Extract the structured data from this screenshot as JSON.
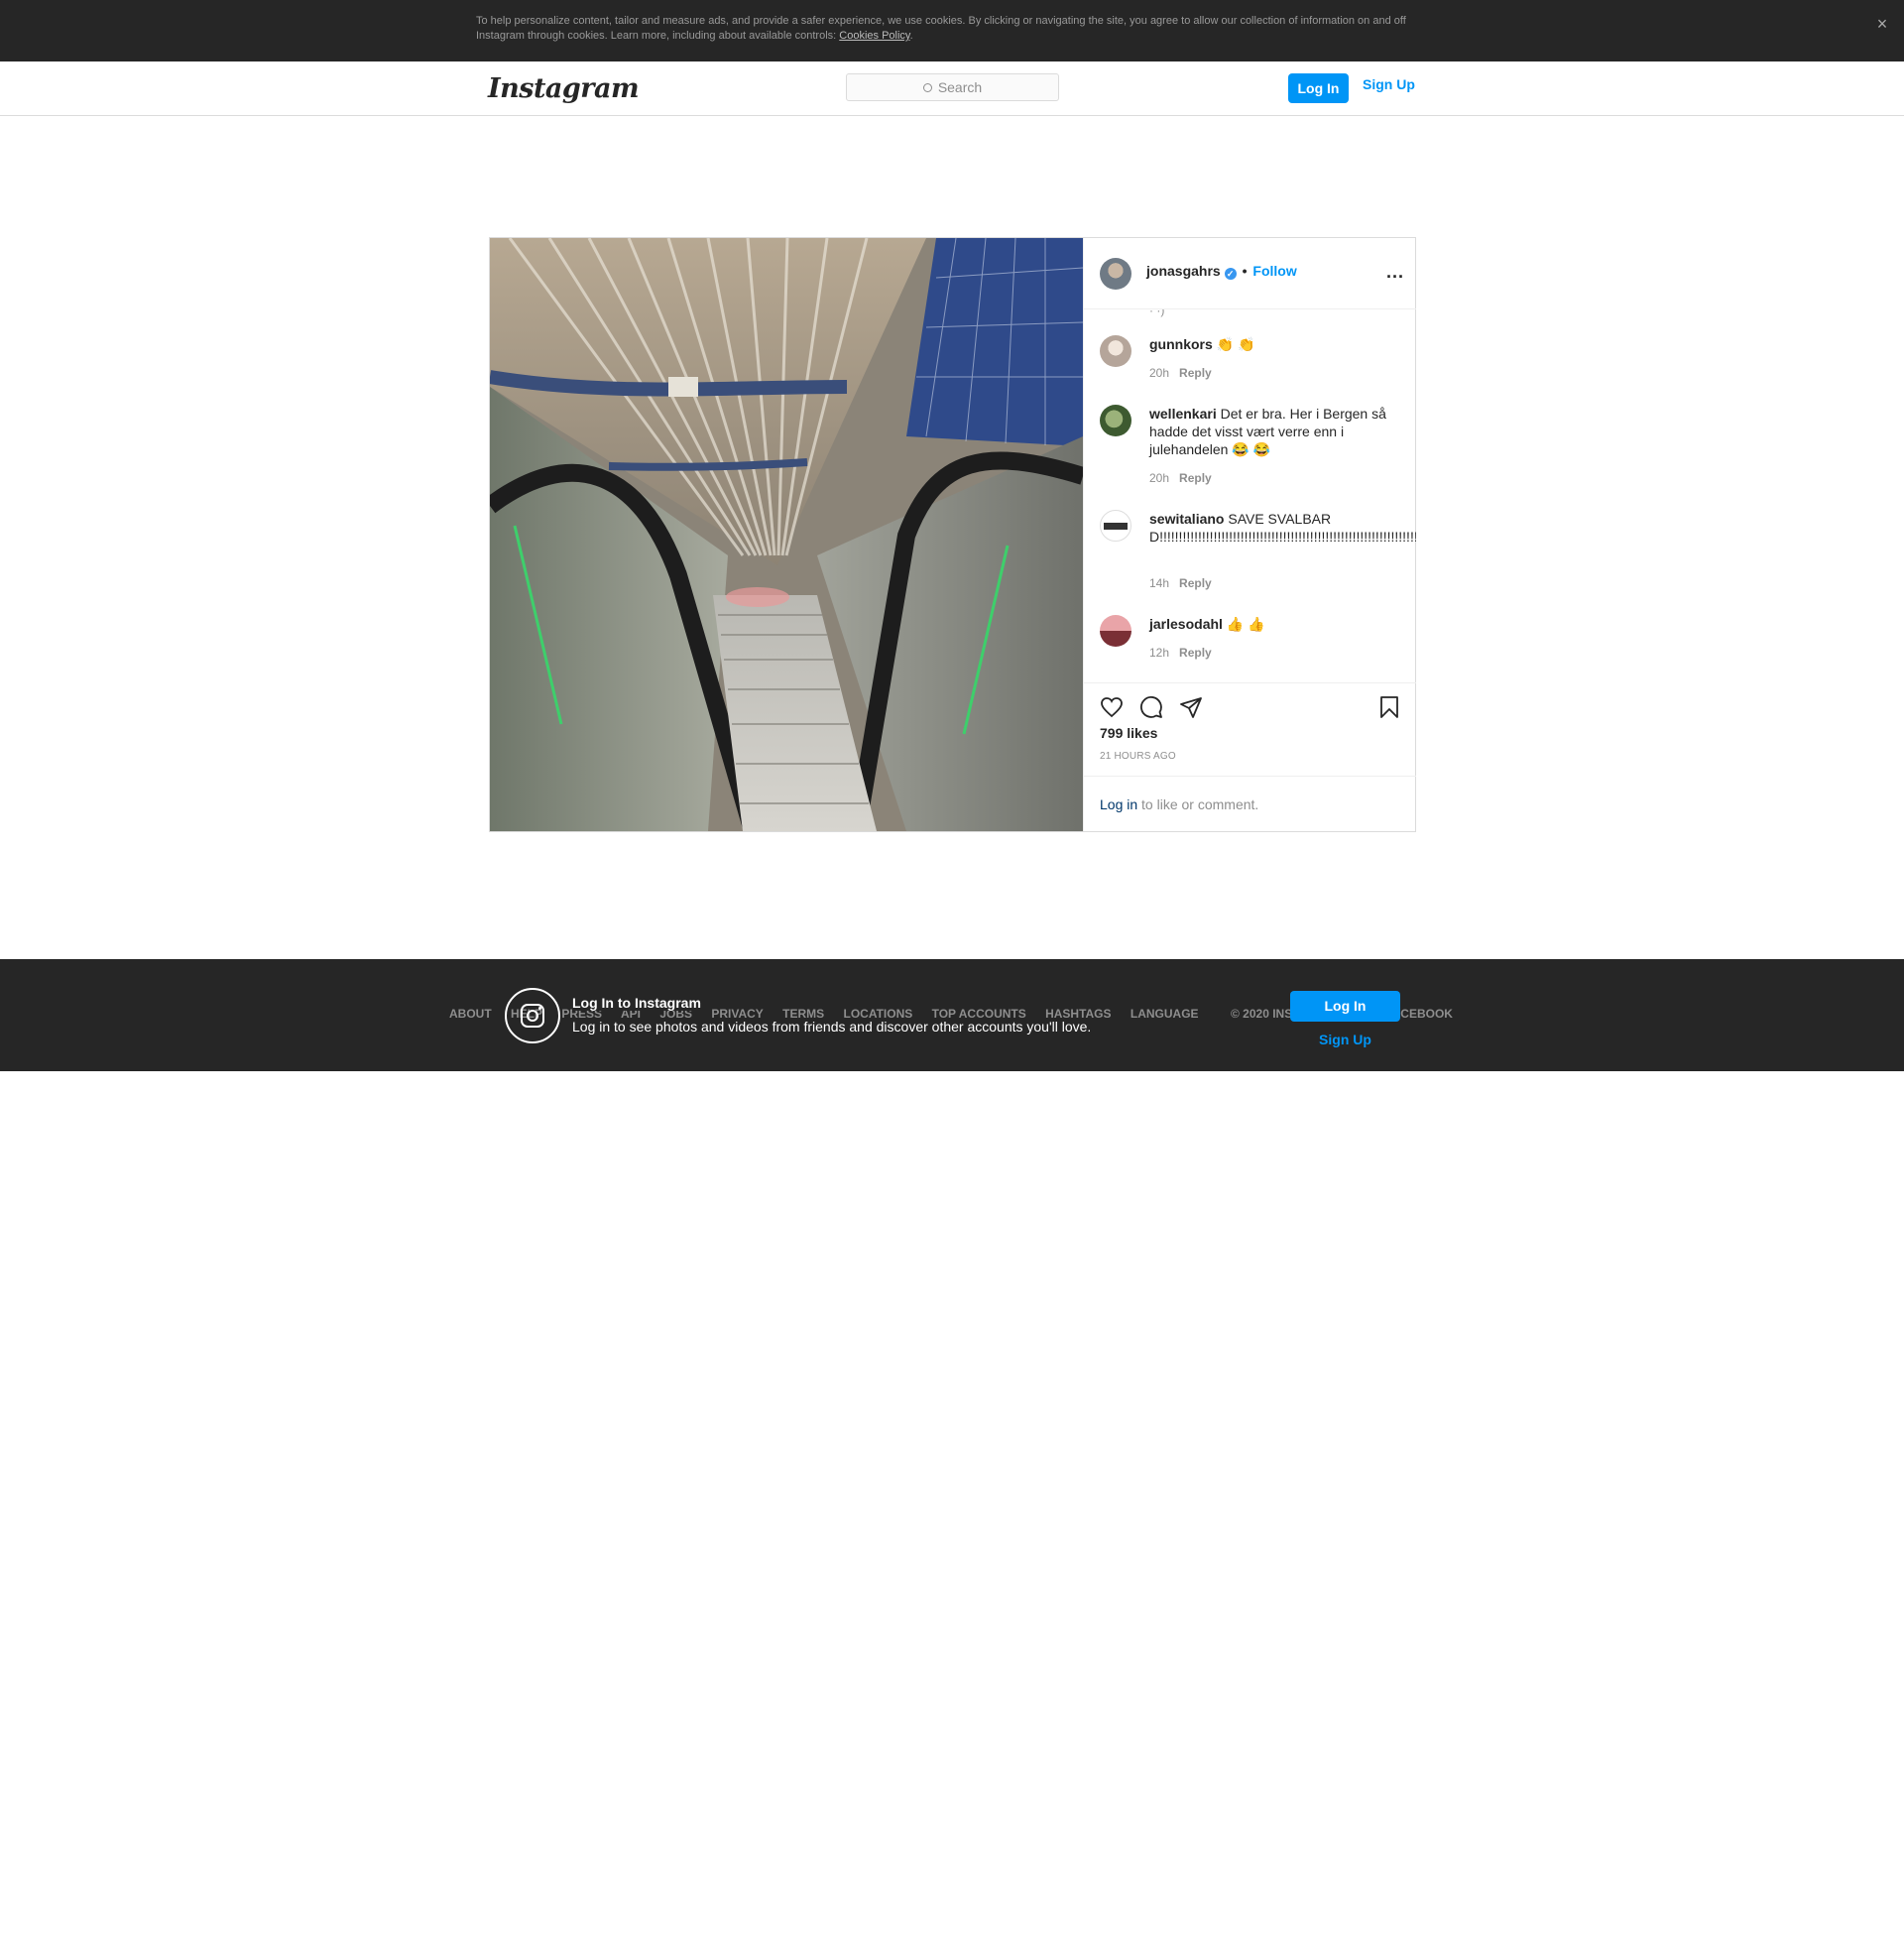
{
  "cookie_banner": {
    "text": "To help personalize content, tailor and measure ads, and provide a safer experience, we use cookies. By clicking or navigating the site, you agree to allow our collection of information on and off Instagram through cookies. Learn more, including about available controls: ",
    "link": "Cookies Policy",
    "period": ".",
    "close": "×"
  },
  "nav": {
    "logo": "Instagram",
    "search_placeholder": "Search",
    "login": "Log In",
    "signup": "Sign Up"
  },
  "post": {
    "username": "jonasgahrs",
    "verified_mark": "✓",
    "separator": "•",
    "follow": "Follow",
    "more": "...",
    "faded_top": "·   ·)",
    "comments": [
      {
        "user": "gunnkors",
        "text": " 👏 👏",
        "time": "20h",
        "reply": "Reply"
      },
      {
        "user": "wellenkari",
        "text": " Det er bra. Her i Bergen så hadde det visst vært verre enn i julehandelen 😂 😂",
        "time": "20h",
        "reply": "Reply"
      },
      {
        "user": "sewitaliano",
        "text": " SAVE SVALBARD!!!!!!!!!!!!!!!!!!!!!!!!!!!!!!!!!!!!!!!!!!!!!!!!!!!!!!!!!!!!!!!!!!!!!!!!!",
        "time": "14h",
        "reply": "Reply"
      },
      {
        "user": "jarlesodahl",
        "text": " 👍 👍",
        "time": "12h",
        "reply": "Reply"
      }
    ],
    "likes": "799 likes",
    "time_ago": "21 HOURS AGO",
    "login_link": "Log in",
    "login_rest": " to like or comment."
  },
  "footer": {
    "links": [
      "ABOUT",
      "HELP",
      "PRESS",
      "API",
      "JOBS",
      "PRIVACY",
      "TERMS",
      "LOCATIONS",
      "TOP ACCOUNTS",
      "HASHTAGS",
      "LANGUAGE"
    ],
    "copyright": "© 2020 INSTAGRAM FROM FACEBOOK",
    "prompt_title": "Log In to Instagram",
    "prompt_sub": "Log in to see photos and videos from friends and discover other accounts you'll love.",
    "login": "Log In",
    "signup": "Sign Up",
    "close": "×"
  },
  "colors": {
    "accent": "#0095f6",
    "dark_bar": "#262626",
    "verified": "#3897f0"
  }
}
